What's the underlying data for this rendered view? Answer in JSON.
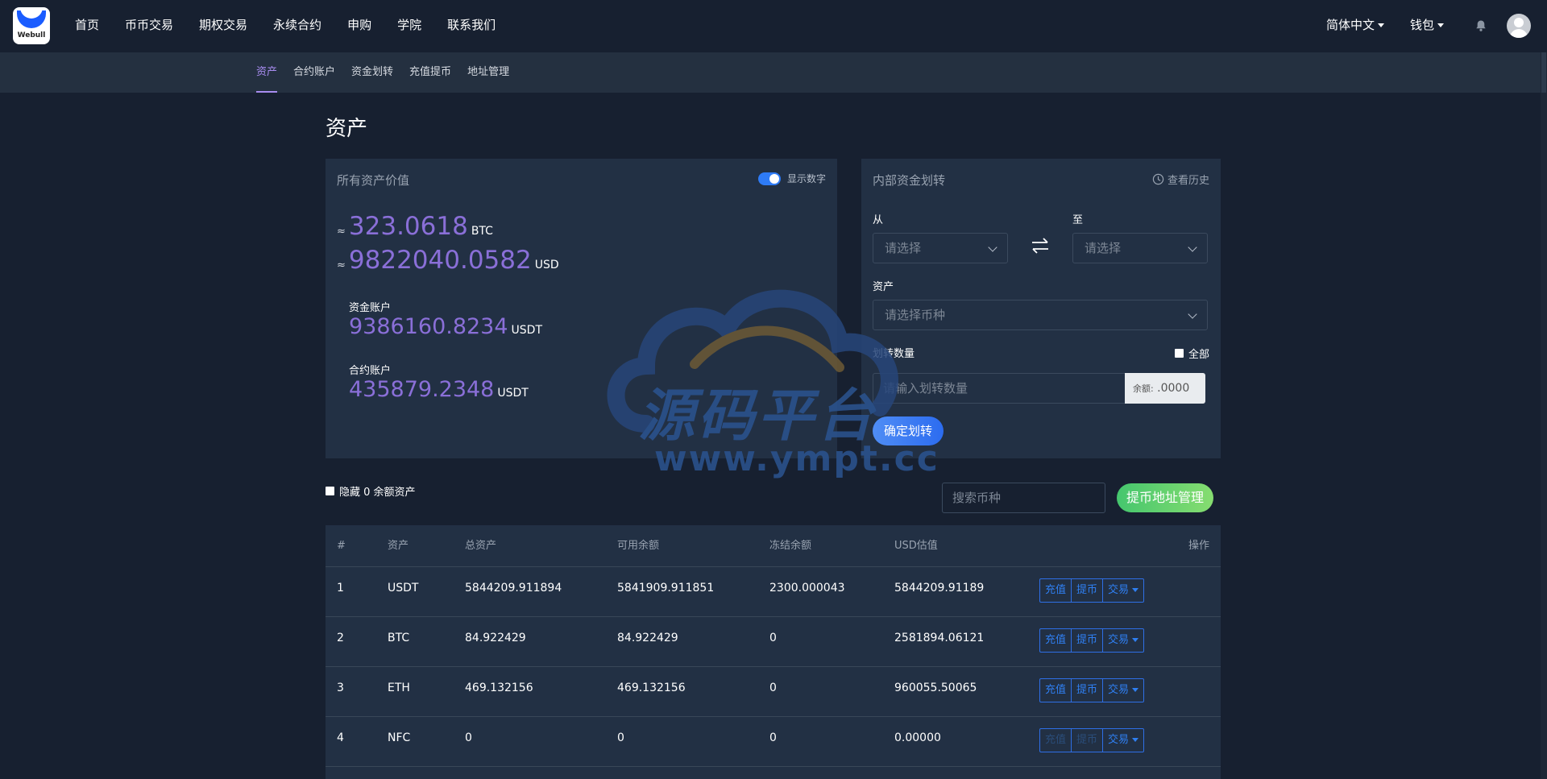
{
  "logo": {
    "text": "Webull"
  },
  "nav": {
    "items": [
      "首页",
      "币币交易",
      "期权交易",
      "永续合约",
      "申购",
      "学院",
      "联系我们"
    ]
  },
  "topright": {
    "language": "简体中文",
    "wallet": "钱包"
  },
  "subnav": {
    "items": [
      "资产",
      "合约账户",
      "资金划转",
      "充值提币",
      "地址管理"
    ],
    "active": "资产"
  },
  "page": {
    "title": "资产"
  },
  "assets_card": {
    "title": "所有资产价值",
    "toggle_label": "显示数字",
    "approx_symbol": "≈",
    "btc_value": "323.0618",
    "btc_unit": "BTC",
    "usd_value": "9822040.0582",
    "usd_unit": "USD",
    "fund_account_label": "资金账户",
    "fund_account_value": "9386160.8234",
    "fund_account_unit": "USDT",
    "contract_account_label": "合约账户",
    "contract_account_value": "435879.2348",
    "contract_account_unit": "USDT"
  },
  "transfer_card": {
    "title": "内部资金划转",
    "history_label": "查看历史",
    "from_label": "从",
    "to_label": "至",
    "from_placeholder": "请选择",
    "to_placeholder": "请选择",
    "asset_label": "资产",
    "asset_placeholder": "请选择币种",
    "amount_label": "划转数量",
    "all_label": "全部",
    "amount_placeholder": "请输入划转数量",
    "balance_label": "余额:",
    "balance_value": ".0000",
    "confirm_label": "确定划转"
  },
  "filters": {
    "hide_zero_label": "隐藏 0 余额资产",
    "search_placeholder": "搜索币种",
    "address_button": "提币地址管理"
  },
  "table": {
    "headers": [
      "#",
      "资产",
      "总资产",
      "可用余额",
      "冻结余额",
      "USD估值",
      "操作"
    ],
    "action_labels": {
      "deposit": "充值",
      "withdraw": "提币",
      "trade": "交易"
    },
    "rows": [
      {
        "index": "1",
        "asset": "USDT",
        "total": "5844209.911894",
        "available": "5841909.911851",
        "frozen": "2300.000043",
        "usd": "5844209.91189"
      },
      {
        "index": "2",
        "asset": "BTC",
        "total": "84.922429",
        "available": "84.922429",
        "frozen": "0",
        "usd": "2581894.06121"
      },
      {
        "index": "3",
        "asset": "ETH",
        "total": "469.132156",
        "available": "469.132156",
        "frozen": "0",
        "usd": "960055.50065"
      },
      {
        "index": "4",
        "asset": "NFC",
        "total": "0",
        "available": "0",
        "frozen": "0",
        "usd": "0.00000"
      }
    ]
  },
  "watermark": {
    "title": "源码平台",
    "url": "www.ympt.cc"
  },
  "colors": {
    "background": "#172030",
    "card": "#223044",
    "accent_purple": "#8a6fd8",
    "accent_blue": "#2f7ff2",
    "accent_green": "#45c66e"
  }
}
